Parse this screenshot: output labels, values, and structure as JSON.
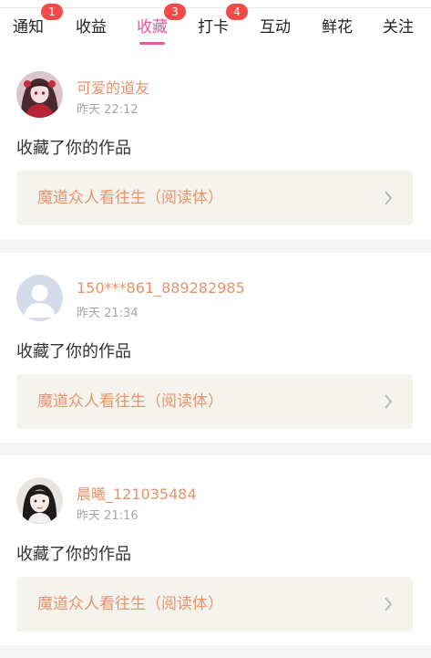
{
  "tabs": [
    {
      "label": "通知",
      "badge": "1",
      "active": false
    },
    {
      "label": "收益",
      "badge": "",
      "active": false
    },
    {
      "label": "收藏",
      "badge": "3",
      "active": true
    },
    {
      "label": "打卡",
      "badge": "4",
      "active": false
    },
    {
      "label": "互动",
      "badge": "",
      "active": false
    },
    {
      "label": "鲜花",
      "badge": "",
      "active": false
    },
    {
      "label": "关注",
      "badge": "",
      "active": false
    }
  ],
  "notifications": [
    {
      "username": "可爱的道友",
      "time": "昨天 22:12",
      "action": "收藏了你的作品",
      "work_title": "魔道众人看往生（阅读体）",
      "avatar": "anime-girl-avatar-icon"
    },
    {
      "username": "150***861_889282985",
      "time": "昨天 21:34",
      "action": "收藏了你的作品",
      "work_title": "魔道众人看往生（阅读体）",
      "avatar": "default-user-avatar-icon"
    },
    {
      "username": "晨曦_121035484",
      "time": "昨天 21:16",
      "action": "收藏了你的作品",
      "work_title": "魔道众人看往生（阅读体）",
      "avatar": "portrait-avatar-icon"
    }
  ],
  "colors": {
    "accent_pink": "#e35a9c",
    "badge_red": "#f04a4a",
    "name_orange": "#e8946a",
    "card_bg": "#f4f3ed",
    "page_bg": "#f5f5f5"
  }
}
